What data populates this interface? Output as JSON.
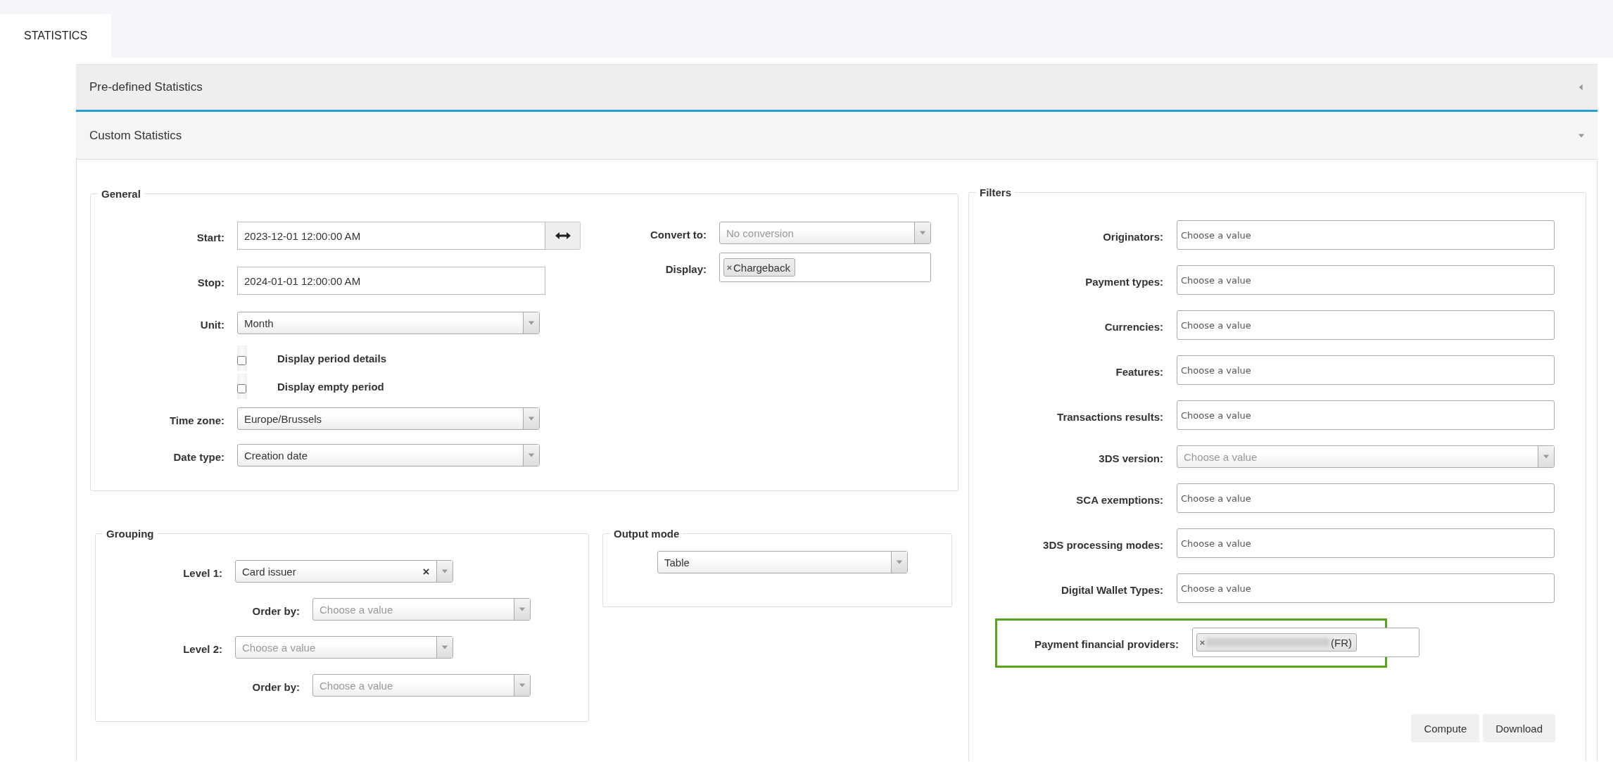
{
  "tabs": [
    {
      "label": "STATISTICS",
      "selected": true
    }
  ],
  "accordion": [
    {
      "title": "Pre-defined Statistics",
      "expanded": false
    },
    {
      "title": "Custom Statistics",
      "expanded": true
    }
  ],
  "general": {
    "legend": "General",
    "left": [
      {
        "kind": "text",
        "label": "Start:",
        "value": "2023-12-01 12:00:00 AM",
        "swap": true
      },
      {
        "kind": "text",
        "label": "Stop:",
        "value": "2024-01-01 12:00:00 AM"
      },
      {
        "kind": "select",
        "label": "Unit:",
        "value": "Month"
      },
      {
        "kind": "checkbox",
        "text": "Display period details",
        "checked": false
      },
      {
        "kind": "checkbox",
        "text": "Display empty period",
        "checked": false
      },
      {
        "kind": "select",
        "label": "Time zone:",
        "value": "Europe/Brussels"
      },
      {
        "kind": "select",
        "label": "Date type:",
        "value": "Creation date"
      }
    ],
    "right": [
      {
        "kind": "select",
        "label": "Convert to:",
        "placeholder": "No conversion"
      },
      {
        "kind": "tags",
        "label": "Display:",
        "tags": [
          {
            "text": "Chargeback"
          }
        ]
      }
    ]
  },
  "grouping": {
    "legend": "Grouping",
    "rows": [
      {
        "kind": "level",
        "label": "Level 1:",
        "value": "Card issuer",
        "clearable": true
      },
      {
        "kind": "order",
        "label": "Order by:",
        "placeholder": "Choose a value"
      },
      {
        "kind": "level",
        "label": "Level 2:",
        "placeholder": "Choose a value"
      },
      {
        "kind": "order",
        "label": "Order by:",
        "placeholder": "Choose a value"
      }
    ]
  },
  "output_mode": {
    "legend": "Output mode",
    "value": "Table"
  },
  "filters": {
    "legend": "Filters",
    "items": [
      {
        "kind": "multi",
        "label": "Originators:",
        "placeholder": "Choose a value"
      },
      {
        "kind": "multi",
        "label": "Payment types:",
        "placeholder": "Choose a value"
      },
      {
        "kind": "multi",
        "label": "Currencies:",
        "placeholder": "Choose a value"
      },
      {
        "kind": "multi",
        "label": "Features:",
        "placeholder": "Choose a value"
      },
      {
        "kind": "multi",
        "label": "Transactions results:",
        "placeholder": "Choose a value"
      },
      {
        "kind": "select",
        "label": "3DS version:",
        "placeholder": "Choose a value"
      },
      {
        "kind": "multi",
        "label": "SCA exemptions:",
        "placeholder": "Choose a value"
      },
      {
        "kind": "multi",
        "label": "3DS processing modes:",
        "placeholder": "Choose a value"
      },
      {
        "kind": "multi",
        "label": "Digital Wallet Types:",
        "placeholder": "Choose a value"
      },
      {
        "kind": "tags",
        "label": "Payment financial providers:",
        "highlighted": true,
        "tags": [
          {
            "text": "(FR)",
            "redacted": true
          }
        ]
      }
    ]
  },
  "buttons": [
    "Compute",
    "Download"
  ]
}
